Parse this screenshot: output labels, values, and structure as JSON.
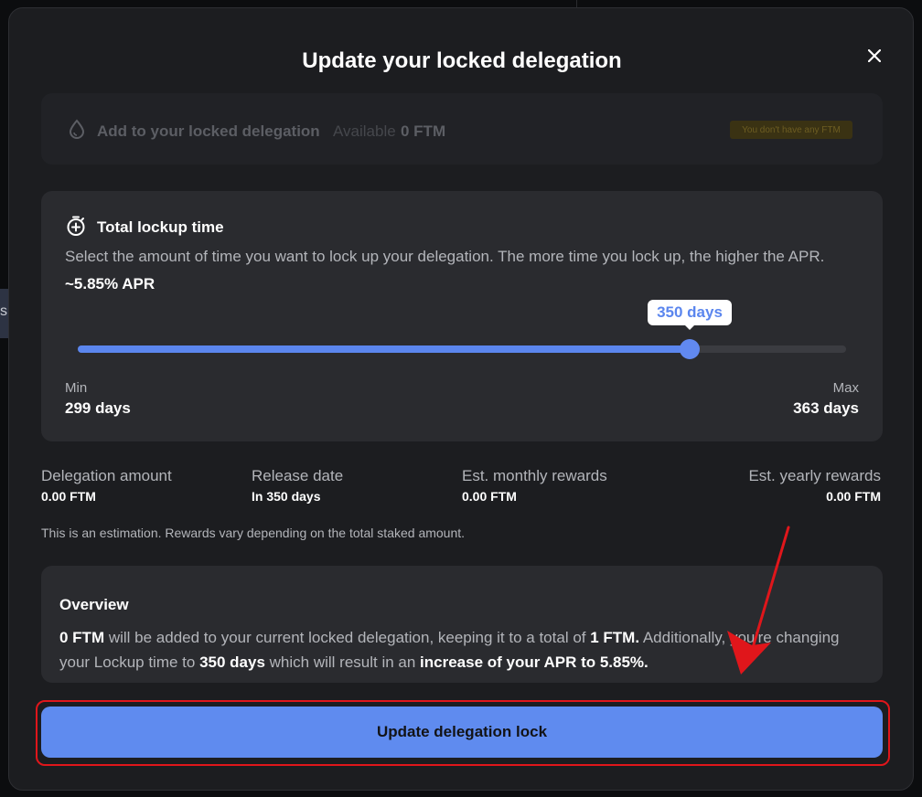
{
  "modal": {
    "title": "Update your locked delegation",
    "close_icon": "close-icon"
  },
  "add_delegation": {
    "icon": "droplet-icon",
    "label": "Add to your locked delegation",
    "available_label": "Available",
    "available_value": "0 FTM",
    "badge": "You don't have any FTM"
  },
  "lockup": {
    "icon": "timer-plus-icon",
    "title": "Total lockup time",
    "description": "Select the amount of time you want to lock up your delegation. The more time you lock up, the higher the APR.",
    "apr": "~5.85% APR",
    "slider": {
      "min_days": 299,
      "max_days": 363,
      "value_days": 350,
      "tooltip": "350 days",
      "fill_color": "#5b86ee"
    },
    "min_label": "Min",
    "min_value": "299 days",
    "max_label": "Max",
    "max_value": "363 days"
  },
  "stats": {
    "delegation_amount": {
      "label": "Delegation amount",
      "value_strong": "0",
      "value_rest": ".00 FTM"
    },
    "release_date": {
      "label": "Release date",
      "value": "In 350 days"
    },
    "monthly_rewards": {
      "label": "Est. monthly rewards",
      "value_strong": "0",
      "value_rest": ".00 FTM"
    },
    "yearly_rewards": {
      "label": "Est. yearly rewards",
      "value_strong": "0",
      "value_rest": ".00 FTM"
    }
  },
  "note": "This is an estimation. Rewards vary depending on the total staked amount.",
  "overview": {
    "title": "Overview",
    "p1": "0 FTM",
    "p2": " will be added to your current locked delegation, keeping it to a total of ",
    "p3": "1 FTM.",
    "p4": " Additionally, you're changing your Lockup time to ",
    "p5": "350 days",
    "p6": " which will result in an ",
    "p7": "increase of your APR to 5.85%."
  },
  "primary_button": {
    "label": "Update delegation lock"
  },
  "colors": {
    "accent": "#5f8bef",
    "highlight": "#e0161b",
    "badge_bg": "#3a3213"
  },
  "background": {
    "strip_text": "s"
  }
}
